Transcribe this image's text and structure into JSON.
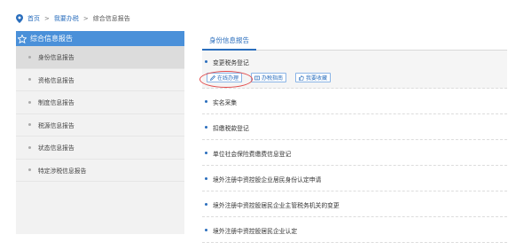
{
  "breadcrumb": {
    "home": "首页",
    "sep1": ">",
    "level2": "我要办税",
    "sep2": ">",
    "current": "综合信息报告"
  },
  "sidebar": {
    "title": "综合信息报告",
    "items": [
      {
        "label": "身份信息报告",
        "active": true
      },
      {
        "label": "资格信息报告",
        "active": false
      },
      {
        "label": "制度信息报告",
        "active": false
      },
      {
        "label": "税源信息报告",
        "active": false
      },
      {
        "label": "状态信息报告",
        "active": false
      },
      {
        "label": "特定涉税信息报告",
        "active": false
      }
    ]
  },
  "main": {
    "tab": "身份信息报告",
    "rows": [
      {
        "title": "变更税务登记",
        "actions": [
          "在线办理",
          "办税指南",
          "我要收藏"
        ]
      },
      {
        "title": "实名采集"
      },
      {
        "title": "扣缴税款登记"
      },
      {
        "title": "单位社会保险费缴费信息登记"
      },
      {
        "title": "境外注册中资控股企业居民身份认定申请"
      },
      {
        "title": "境外注册中资控股居民企业主管税务机关的变更"
      },
      {
        "title": "境外注册中资控股居民企业认定"
      }
    ]
  },
  "colors": {
    "accent": "#2a6ebd",
    "sidebar_header": "#4a90d9",
    "highlight_circle": "#e24a4a"
  }
}
